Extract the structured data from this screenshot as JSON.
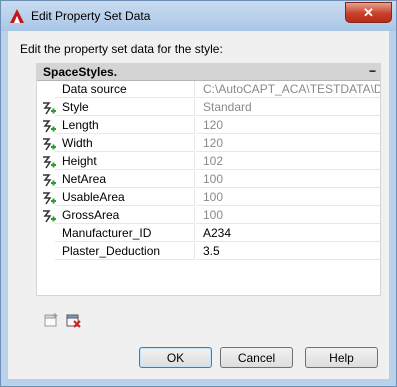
{
  "window": {
    "title": "Edit Property Set Data",
    "close_label": "✕"
  },
  "dialog": {
    "instruction": "Edit the property set data for the style:"
  },
  "property_set": {
    "name": "SpaceStyles.",
    "collapse_symbol": "−",
    "rows": [
      {
        "name": "Data source",
        "value": "C:\\AutoCAPT_ACA\\TESTDATA\\D...",
        "linked": false,
        "editable": false
      },
      {
        "name": "Style",
        "value": "Standard",
        "linked": true,
        "editable": false
      },
      {
        "name": "Length",
        "value": "120",
        "linked": true,
        "editable": false
      },
      {
        "name": "Width",
        "value": "120",
        "linked": true,
        "editable": false
      },
      {
        "name": "Height",
        "value": "102",
        "linked": true,
        "editable": false
      },
      {
        "name": "NetArea",
        "value": "100",
        "linked": true,
        "editable": false
      },
      {
        "name": "UsableArea",
        "value": "100",
        "linked": true,
        "editable": false
      },
      {
        "name": "GrossArea",
        "value": "100",
        "linked": true,
        "editable": false
      },
      {
        "name": "Manufacturer_ID",
        "value": "A234",
        "linked": false,
        "editable": true
      },
      {
        "name": "Plaster_Deduction",
        "value": "3.5",
        "linked": false,
        "editable": true
      }
    ]
  },
  "toolbar": {
    "add_icon": "add-property-sets-icon",
    "remove_icon": "remove-property-sets-icon"
  },
  "buttons": {
    "ok": "OK",
    "cancel": "Cancel",
    "help": "Help"
  },
  "colors": {
    "link_icon_green": "#2e9e2e",
    "remove_icon_red": "#d01c1c",
    "app_icon_red": "#c4161c"
  }
}
